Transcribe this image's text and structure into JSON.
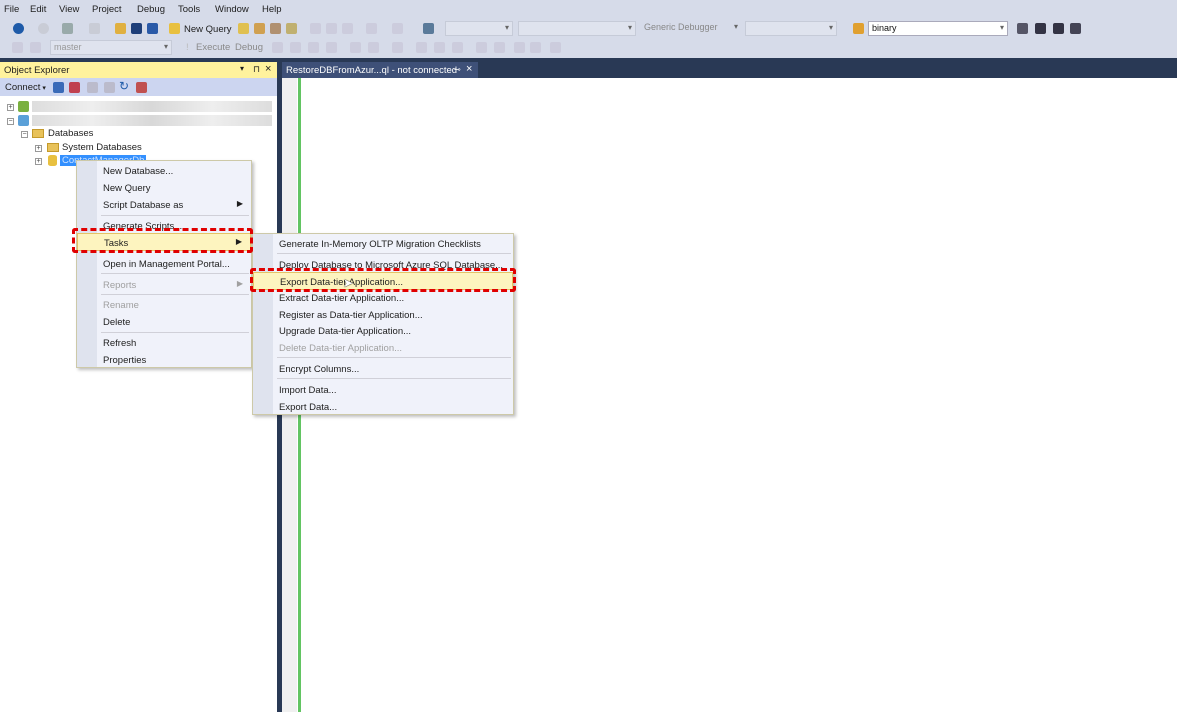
{
  "menubar": [
    "File",
    "Edit",
    "View",
    "Project",
    "Debug",
    "Tools",
    "Window",
    "Help"
  ],
  "toolbar1": {
    "new_query": "New Query",
    "solution_config": "Generic Debugger",
    "search_value": "binary"
  },
  "toolbar2": {
    "database": "master",
    "execute": "Execute",
    "debug": "Debug"
  },
  "object_explorer": {
    "title": "Object Explorer",
    "connect": "Connect",
    "tree": {
      "databases": "Databases",
      "system_databases": "System Databases",
      "selected_db": "ContactManagerDb"
    }
  },
  "editor_tab": {
    "label": "RestoreDBFromAzur...ql - not connected"
  },
  "context_menu": [
    {
      "label": "New Database...",
      "enabled": true
    },
    {
      "label": "New Query",
      "enabled": true
    },
    {
      "label": "Script Database as",
      "enabled": true,
      "submenu": true
    },
    {
      "label": "Generate Scripts...",
      "enabled": true
    },
    {
      "label": "Tasks",
      "enabled": true,
      "submenu": true,
      "highlighted": true
    },
    {
      "label": "Open in Management Portal...",
      "enabled": true
    },
    {
      "label": "Reports",
      "enabled": false,
      "submenu": true
    },
    {
      "label": "Rename",
      "enabled": false
    },
    {
      "label": "Delete",
      "enabled": true
    },
    {
      "label": "Refresh",
      "enabled": true
    },
    {
      "label": "Properties",
      "enabled": true
    }
  ],
  "tasks_submenu": [
    {
      "label": "Generate In-Memory OLTP Migration Checklists",
      "enabled": true
    },
    {
      "label": "Deploy Database to Microsoft Azure SQL Database...",
      "enabled": true
    },
    {
      "label": "Export Data-tier Application...",
      "enabled": true,
      "highlighted": true
    },
    {
      "label": "Extract Data-tier Application...",
      "enabled": true
    },
    {
      "label": "Register as Data-tier Application...",
      "enabled": true
    },
    {
      "label": "Upgrade Data-tier Application...",
      "enabled": true
    },
    {
      "label": "Delete Data-tier Application...",
      "enabled": false
    },
    {
      "label": "Encrypt Columns...",
      "enabled": true
    },
    {
      "label": "Import Data...",
      "enabled": true
    },
    {
      "label": "Export Data...",
      "enabled": true
    }
  ],
  "colors": {
    "highlight_box": "#e00000",
    "title_bar": "#293955",
    "panel_header": "#fff29d"
  }
}
